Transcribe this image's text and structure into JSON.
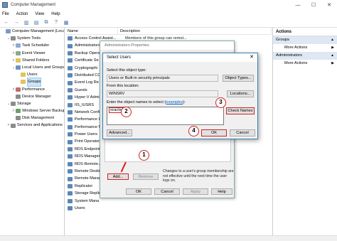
{
  "window": {
    "title": "Computer Management",
    "min": "—",
    "max": "☐",
    "close": "✕"
  },
  "menu": [
    "File",
    "Action",
    "View",
    "Help"
  ],
  "toolbar": [
    "←",
    "→",
    "▥",
    "▤",
    "⧉",
    "?",
    "▦"
  ],
  "tree": [
    {
      "label": "Computer Management (Local",
      "indent": 0,
      "exp": "",
      "icon": "#7a9cc6"
    },
    {
      "label": "System Tools",
      "indent": 1,
      "exp": "⌄",
      "icon": "#8c8c8c"
    },
    {
      "label": "Task Scheduler",
      "indent": 2,
      "exp": ">",
      "icon": "#8faad2"
    },
    {
      "label": "Event Viewer",
      "indent": 2,
      "exp": ">",
      "icon": "#8ca98c"
    },
    {
      "label": "Shared Folders",
      "indent": 2,
      "exp": ">",
      "icon": "#e2c35a"
    },
    {
      "label": "Local Users and Groups",
      "indent": 2,
      "exp": "⌄",
      "icon": "#6d93c4"
    },
    {
      "label": "Users",
      "indent": 3,
      "exp": "",
      "icon": "#e2c35a"
    },
    {
      "label": "Groups",
      "indent": 3,
      "exp": "",
      "icon": "#e2c35a",
      "selected": true
    },
    {
      "label": "Performance",
      "indent": 2,
      "exp": ">",
      "icon": "#c46d6d"
    },
    {
      "label": "Device Manager",
      "indent": 2,
      "exp": "",
      "icon": "#8c8c8c"
    },
    {
      "label": "Storage",
      "indent": 1,
      "exp": "⌄",
      "icon": "#8c8c8c"
    },
    {
      "label": "Windows Server Backup",
      "indent": 2,
      "exp": ">",
      "icon": "#6aa06a"
    },
    {
      "label": "Disk Management",
      "indent": 2,
      "exp": "",
      "icon": "#8c8c8c"
    },
    {
      "label": "Services and Applications",
      "indent": 1,
      "exp": ">",
      "icon": "#8c8c8c"
    }
  ],
  "list": {
    "headers": [
      "Name",
      "Description"
    ],
    "rows": [
      {
        "name": "Access Control Assist...",
        "desc": "Members of this group can remot..."
      },
      {
        "name": "Administrators",
        "desc": ""
      },
      {
        "name": "Backup Operat",
        "desc": ""
      },
      {
        "name": "Certificate Se",
        "desc": ""
      },
      {
        "name": "Cryptographi",
        "desc": ""
      },
      {
        "name": "Distributed CC",
        "desc": ""
      },
      {
        "name": "Event Log Re",
        "desc": ""
      },
      {
        "name": "Guests",
        "desc": ""
      },
      {
        "name": "Hyper-V Admin",
        "desc": ""
      },
      {
        "name": "IIS_IUSRS",
        "desc": ""
      },
      {
        "name": "Network Config",
        "desc": ""
      },
      {
        "name": "Performance Lo",
        "desc": ""
      },
      {
        "name": "Performance M",
        "desc": ""
      },
      {
        "name": "Power Users",
        "desc": ""
      },
      {
        "name": "Print Operator",
        "desc": ""
      },
      {
        "name": "RDS Endpoint S",
        "desc": ""
      },
      {
        "name": "RDS Managem",
        "desc": ""
      },
      {
        "name": "RDS Remote A",
        "desc": ""
      },
      {
        "name": "Remote Deskt",
        "desc": ""
      },
      {
        "name": "Remote Mana",
        "desc": ""
      },
      {
        "name": "Replicator",
        "desc": ""
      },
      {
        "name": "Storage Replic",
        "desc": ""
      },
      {
        "name": "System Mana",
        "desc": ""
      },
      {
        "name": "Users",
        "desc": ""
      }
    ]
  },
  "actions": {
    "title": "Actions",
    "sections": [
      {
        "label": "Groups",
        "item": "More Actions"
      },
      {
        "label": "Administrators",
        "item": "More Actions"
      }
    ]
  },
  "props": {
    "title": "Administrators Properties",
    "add": "Add...",
    "remove": "Remove",
    "note": "Changes to a user's group membership are not effective until the next time the user logs on.",
    "ok": "OK",
    "cancel": "Cancel",
    "apply": "Apply",
    "help": "Help"
  },
  "select_users": {
    "title": "Select Users",
    "close": "✕",
    "object_type_label": "Select this object type:",
    "object_type_value": "Users or Built-in security principals",
    "object_types_btn": "Object Types...",
    "location_label": "From this location:",
    "location_value": "WINSRV",
    "locations_btn": "Locations...",
    "enter_label_pre": "Enter the object names to select (",
    "examples_link": "examples",
    "enter_label_post": "):",
    "names_value": "oracle",
    "check_names_btn": "Check Names",
    "advanced_btn": "Advanced...",
    "ok_btn": "OK",
    "cancel_btn": "Cancel"
  },
  "steps": {
    "one": "1",
    "two": "2",
    "three": "3",
    "four": "4"
  },
  "highlight_color": "#d6201f"
}
